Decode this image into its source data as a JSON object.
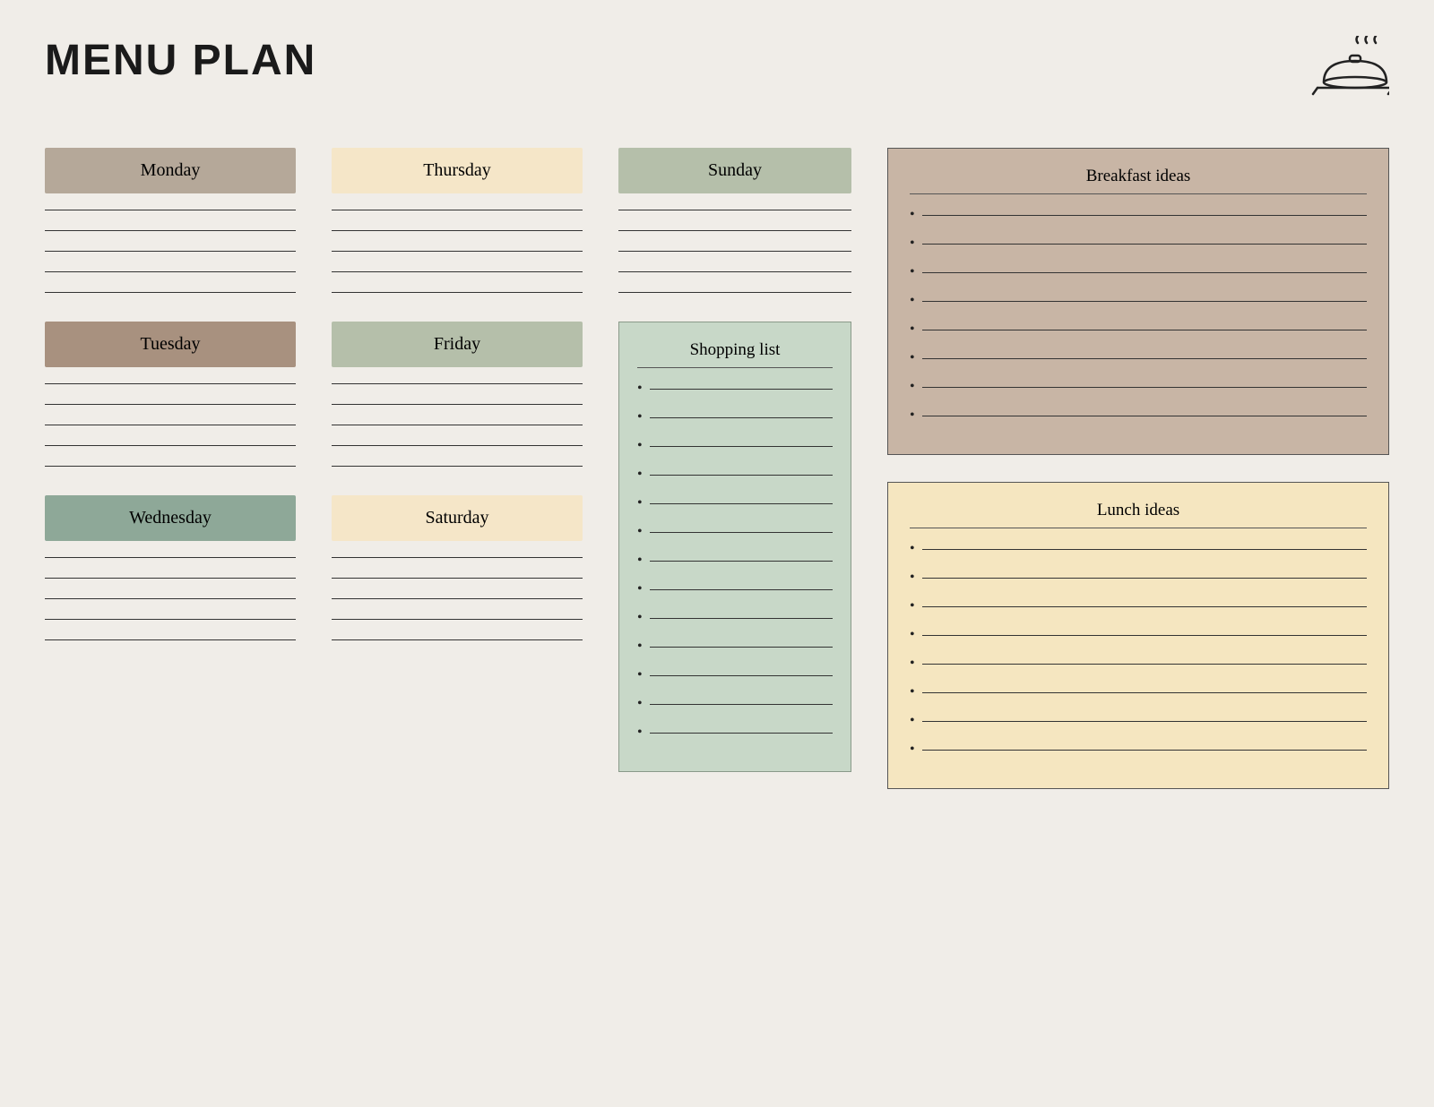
{
  "title": "MENU PLAN",
  "days": {
    "monday": {
      "label": "Monday",
      "color_class": "monday-label",
      "lines": 5
    },
    "tuesday": {
      "label": "Tuesday",
      "color_class": "tuesday-label",
      "lines": 5
    },
    "wednesday": {
      "label": "Wednesday",
      "color_class": "wednesday-label",
      "lines": 5
    },
    "thursday": {
      "label": "Thursday",
      "color_class": "thursday-label",
      "lines": 5
    },
    "friday": {
      "label": "Friday",
      "color_class": "friday-label",
      "lines": 5
    },
    "saturday": {
      "label": "Saturday",
      "color_class": "saturday-label",
      "lines": 5
    },
    "sunday": {
      "label": "Sunday",
      "color_class": "sunday-label",
      "lines": 5
    }
  },
  "shopping_list": {
    "title": "Shopping list",
    "items": 13
  },
  "breakfast_ideas": {
    "title": "Breakfast ideas",
    "items": 8
  },
  "lunch_ideas": {
    "title": "Lunch ideas",
    "items": 8
  }
}
